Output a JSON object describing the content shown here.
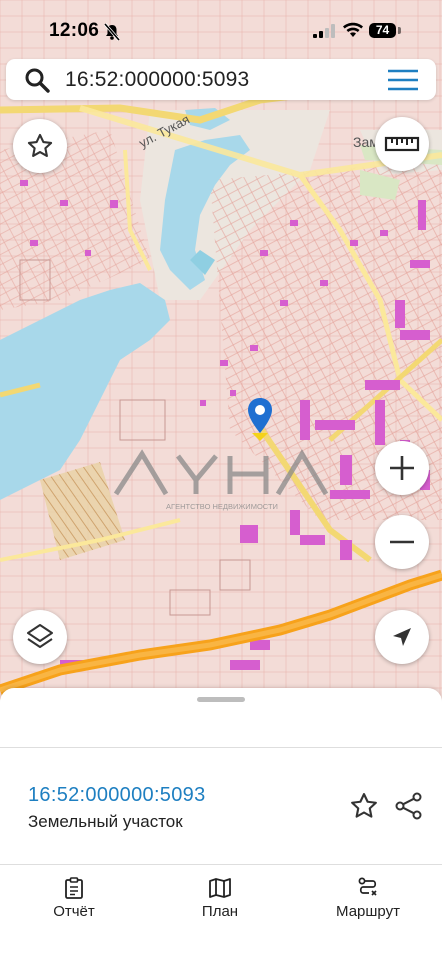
{
  "status_bar": {
    "time": "12:06",
    "battery_level": "74",
    "icons": [
      "bell-slash-icon",
      "cellular-signal-icon",
      "wifi-icon",
      "battery-icon"
    ]
  },
  "search": {
    "query": "16:52:000000:5093",
    "icon": "search-icon",
    "menu_icon": "hamburger-menu-icon"
  },
  "map": {
    "labels": {
      "street_tukaya": "ул. Тукая",
      "district_top_right": "Зам"
    },
    "watermark": {
      "logo_text": "ЛУНА",
      "subtitle": "АГЕНТСТВО НЕДВИЖИМОСТИ"
    },
    "controls": [
      "favorite-star",
      "ruler",
      "zoom-in",
      "zoom-out",
      "layers",
      "my-location"
    ],
    "colors": {
      "road": "#f7a21b",
      "water": "#a8d8ea",
      "buildings": "#d65ecf",
      "parcels": "#f1dcd7"
    }
  },
  "bottom_sheet": {
    "parcel_number": "16:52:000000:5093",
    "parcel_type": "Земельный участок",
    "accent_color": "#1e7fc1"
  },
  "tabs": [
    {
      "label": "Отчёт",
      "icon": "report-clipboard-icon"
    },
    {
      "label": "План",
      "icon": "map-plan-icon"
    },
    {
      "label": "Маршрут",
      "icon": "route-icon"
    }
  ]
}
